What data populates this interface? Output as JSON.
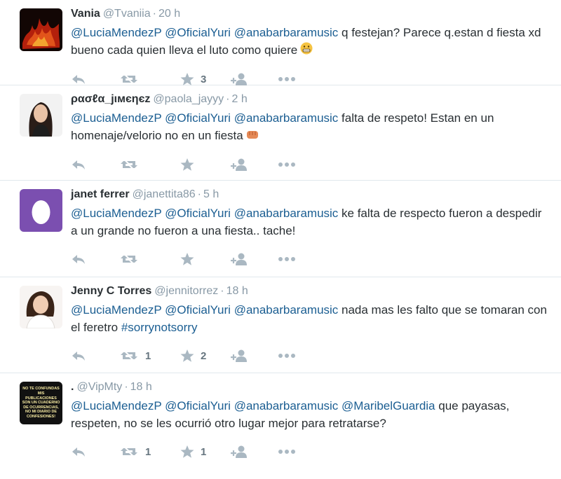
{
  "tweets": [
    {
      "name": "Vania",
      "handle": "@Tvaniia",
      "time": "20 h",
      "text_parts": [
        {
          "t": "@LuciaMendezP",
          "mention": true
        },
        {
          "t": " "
        },
        {
          "t": "@OficialYuri",
          "mention": true
        },
        {
          "t": " "
        },
        {
          "t": "@anabarbaramusic",
          "mention": true
        },
        {
          "t": "  q festejan? Parece q.estan d fiesta xd bueno cada quien lleva el luto como quiere"
        }
      ],
      "emoji": "grimace-emoji",
      "retweets": "",
      "favorites": "3",
      "avatar": "fire-avatar"
    },
    {
      "name": "ρασℓα_jιмєηєz",
      "handle": "@paola_jayyy",
      "time": "2 h",
      "text_parts": [
        {
          "t": "@LuciaMendezP",
          "mention": true
        },
        {
          "t": " "
        },
        {
          "t": "@OficialYuri",
          "mention": true
        },
        {
          "t": " "
        },
        {
          "t": "@anabarbaramusic",
          "mention": true
        },
        {
          "t": " falta de respeto! Estan en un homenaje/velorio no en un fiesta"
        }
      ],
      "emoji": "fist-emoji",
      "retweets": "",
      "favorites": "",
      "avatar": "girl-photo-avatar"
    },
    {
      "name": "janet ferrer",
      "handle": "@janettita86",
      "time": "5 h",
      "text_parts": [
        {
          "t": "@LuciaMendezP",
          "mention": true
        },
        {
          "t": " "
        },
        {
          "t": "@OficialYuri",
          "mention": true
        },
        {
          "t": " "
        },
        {
          "t": "@anabarbaramusic",
          "mention": true
        },
        {
          "t": " ke falta de respecto fueron a despedir a un grande no fueron a una fiesta.. tache!"
        }
      ],
      "emoji": "",
      "retweets": "",
      "favorites": "",
      "avatar": "egg-avatar"
    },
    {
      "name": "Jenny C Torres",
      "handle": "@jennitorrez",
      "time": "18 h",
      "text_parts": [
        {
          "t": "@LuciaMendezP",
          "mention": true
        },
        {
          "t": " "
        },
        {
          "t": "@OficialYuri",
          "mention": true
        },
        {
          "t": " "
        },
        {
          "t": "@anabarbaramusic",
          "mention": true
        },
        {
          "t": " nada mas les falto que se tomaran con el feretro "
        },
        {
          "t": "#sorrynotsorry",
          "mention": true
        }
      ],
      "emoji": "",
      "retweets": "1",
      "favorites": "2",
      "avatar": "woman-photo-avatar"
    },
    {
      "name": ".",
      "handle": "@VipMty",
      "time": "18 h",
      "text_parts": [
        {
          "t": "@LuciaMendezP",
          "mention": true
        },
        {
          "t": " "
        },
        {
          "t": "@OficialYuri",
          "mention": true
        },
        {
          "t": " "
        },
        {
          "t": "@anabarbaramusic",
          "mention": true
        },
        {
          "t": " "
        },
        {
          "t": "@MaribelGuardia",
          "mention": true
        },
        {
          "t": " que payasas, respeten, no se les ocurrió otro lugar mejor para retratarse?"
        }
      ],
      "emoji": "",
      "retweets": "1",
      "favorites": "1",
      "avatar": "quote-avatar",
      "avatar_text": "NO TE CONFUNDAS MIS PUBLICACIONES SON UN CUADERNO DE OCURRENCIAS, NO MI DIARIO DE CONFESIONES!"
    }
  ],
  "colors": {
    "mention": "#1b5e92",
    "meta": "#8899a6",
    "icon": "#aab8c2",
    "egg_bg": "#7b4fb0"
  }
}
